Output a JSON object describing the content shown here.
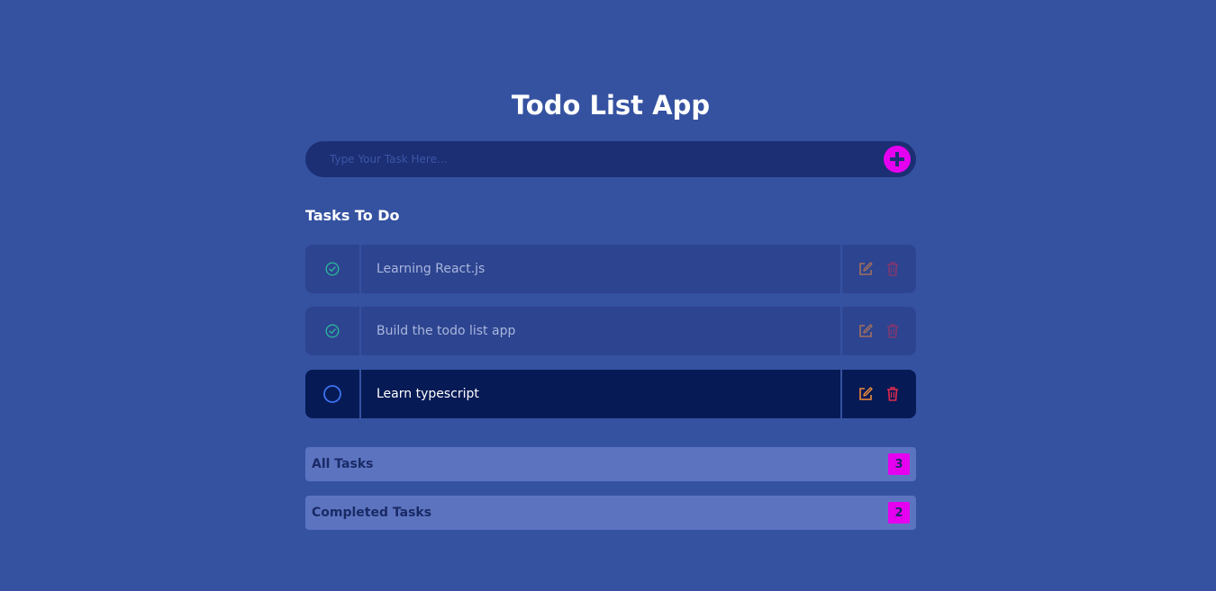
{
  "app": {
    "title": "Todo List App"
  },
  "input": {
    "placeholder": "Type Your Task Here...",
    "value": ""
  },
  "add_button": {
    "icon": "plus-icon",
    "color": "#e600f0"
  },
  "section": {
    "title": "Tasks To Do"
  },
  "tasks": [
    {
      "text": "Learning React.js",
      "completed": true
    },
    {
      "text": "Build the todo list app",
      "completed": true
    },
    {
      "text": "Learn typescript",
      "completed": false
    }
  ],
  "summary": [
    {
      "label": "All Tasks",
      "count": "3"
    },
    {
      "label": "Completed Tasks",
      "count": "2"
    }
  ],
  "colors": {
    "background": "#3552a1",
    "accent": "#e600f0",
    "check_done": "#2bb39a",
    "check_open": "#3e73f0",
    "edit": "#f08a3c",
    "delete": "#e02a4d"
  }
}
